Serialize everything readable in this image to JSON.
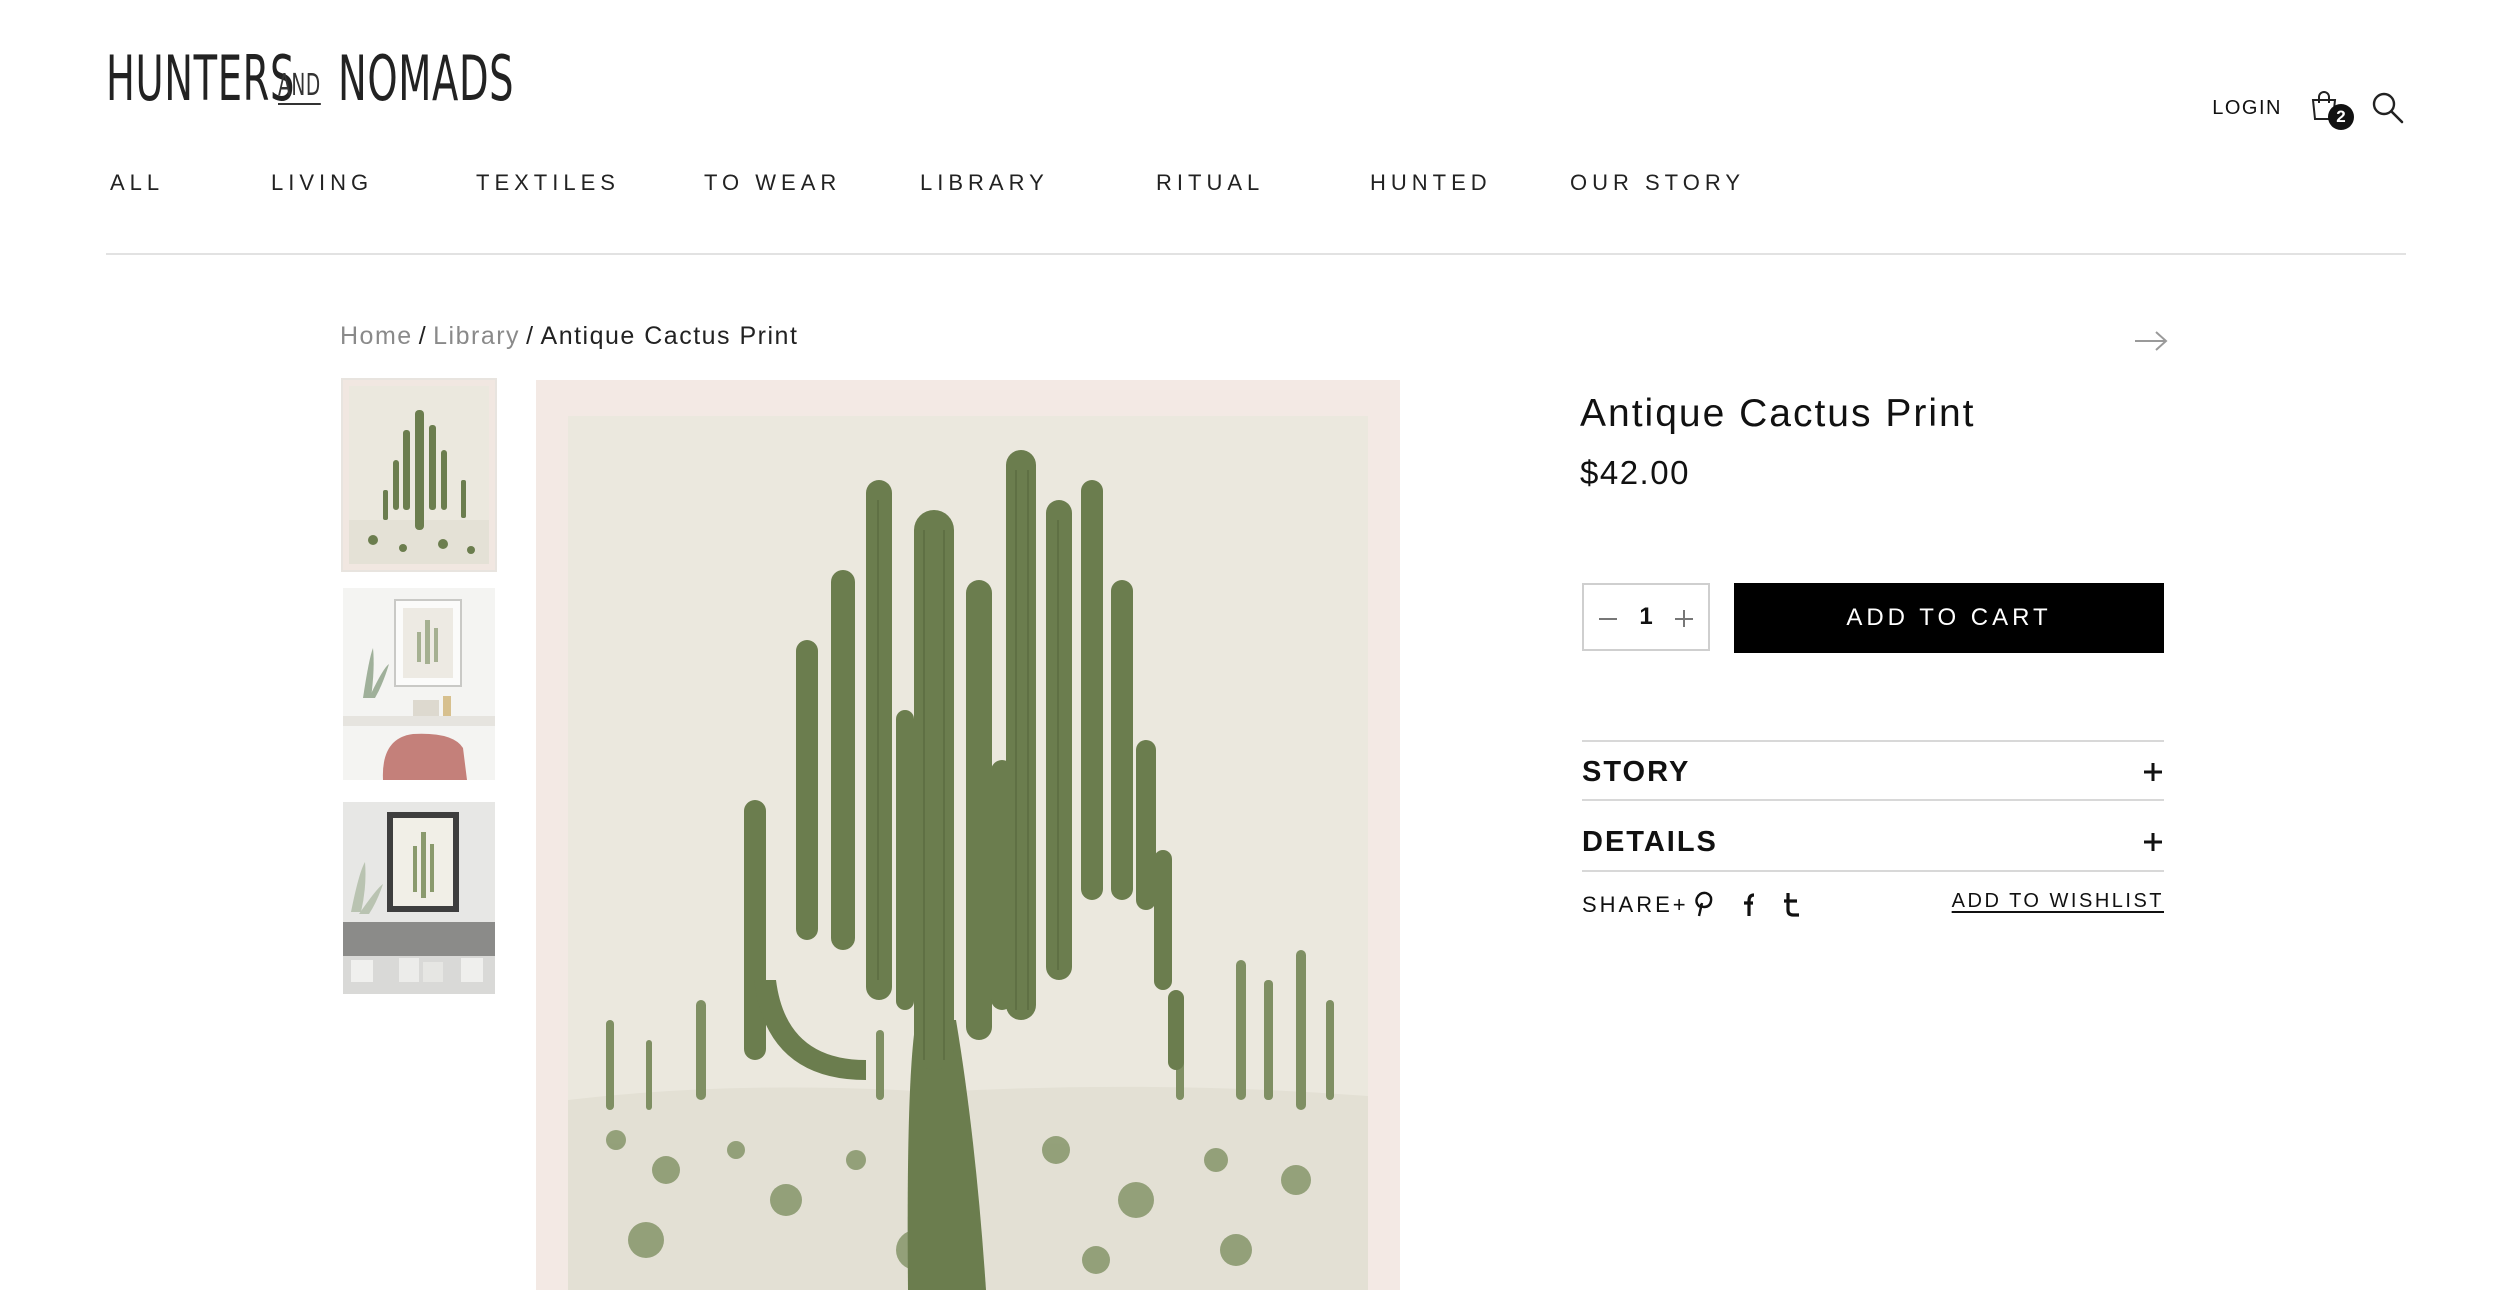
{
  "brand": {
    "word1": "HUNTERS",
    "joiner": "AND",
    "word2": "NOMADS"
  },
  "header": {
    "login_label": "LOGIN",
    "cart_count": "2"
  },
  "nav": {
    "items": [
      "ALL",
      "LIVING",
      "TEXTILES",
      "TO WEAR",
      "LIBRARY",
      "RITUAL",
      "HUNTED",
      "OUR STORY"
    ]
  },
  "breadcrumb": {
    "home": "Home",
    "sep": "/",
    "category": "Library",
    "current": "Antique Cactus Print"
  },
  "product": {
    "title": "Antique Cactus Print",
    "price": "$42.00",
    "quantity": "1",
    "add_to_cart": "ADD TO CART",
    "accordion": [
      {
        "label": "STORY"
      },
      {
        "label": "DETAILS"
      }
    ],
    "share_label": "SHARE+",
    "wishlist_label": "ADD TO WISHLIST"
  },
  "icons": {
    "cart": "shopping-bag-icon",
    "search": "search-icon",
    "next": "arrow-right-icon",
    "social": [
      "pinterest-icon",
      "facebook-icon",
      "tumblr-icon"
    ]
  },
  "colors": {
    "accent": "#000000",
    "cactus_green": "#6b7d4e",
    "print_paper": "#ebe8de",
    "image_frame": "#f3e9e4",
    "muted_link": "#8a8a8a"
  }
}
